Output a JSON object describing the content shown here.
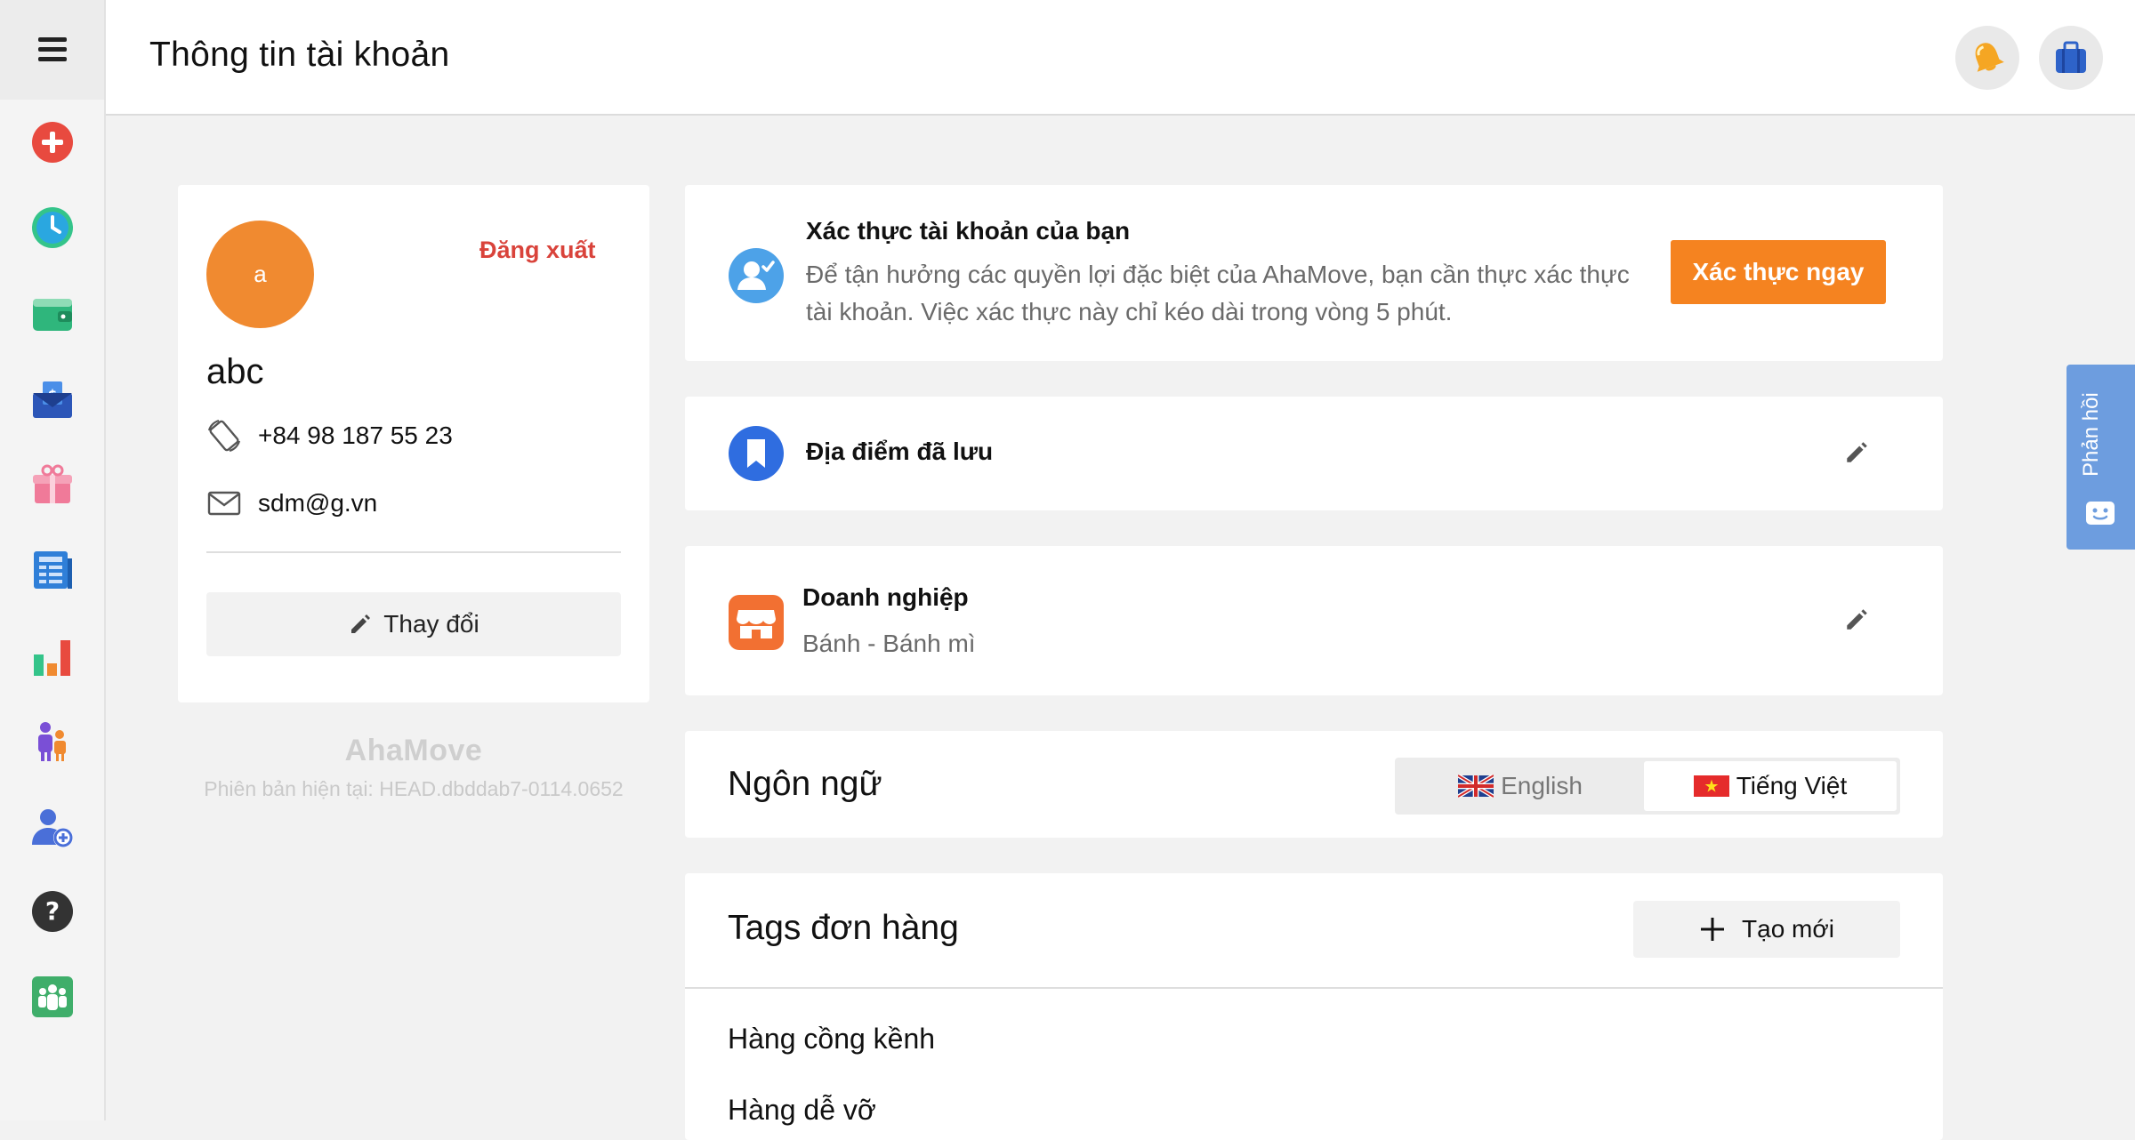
{
  "header": {
    "title": "Thông tin tài khoản",
    "notification_icon": "bell-icon",
    "jobs_icon": "briefcase-icon"
  },
  "sidebar": {
    "items": [
      {
        "icon": "create-order-icon",
        "color": "#e84a3f"
      },
      {
        "icon": "history-clock-icon",
        "color": "#2aa7e0"
      },
      {
        "icon": "wallet-icon",
        "color": "#2fb67c"
      },
      {
        "icon": "cod-payment-icon",
        "color": "#2c56b8"
      },
      {
        "icon": "gift-icon",
        "color": "#f07a99"
      },
      {
        "icon": "report-list-icon",
        "color": "#2f7fd8"
      },
      {
        "icon": "statistics-chart-icon",
        "color": "#f08a30"
      },
      {
        "icon": "team-icon",
        "color": "#7a4fd6"
      },
      {
        "icon": "add-user-icon",
        "color": "#4a6fd8"
      },
      {
        "icon": "help-icon",
        "color": "#333333"
      },
      {
        "icon": "community-icon",
        "color": "#3fae6a"
      }
    ]
  },
  "profile": {
    "avatar_letter": "a",
    "avatar_color": "#f08a30",
    "logout_label": "Đăng xuất",
    "name": "abc",
    "phone": "+84 98 187 55 23",
    "email": "sdm@g.vn",
    "change_label": "Thay đổi"
  },
  "brand": {
    "name": "AhaMove",
    "version": "Phiên bản hiện tại: HEAD.dbddab7-0114.0652"
  },
  "verify": {
    "title": "Xác thực tài khoản của bạn",
    "description": "Để tận hưởng các quyền lợi đặc biệt của AhaMove, bạn cần thực xác thực tài khoản. Việc xác thực này chỉ kéo dài trong vòng 5 phút.",
    "button_label": "Xác thực ngay",
    "accent": "#f58320"
  },
  "saved_places": {
    "title": "Địa điểm đã lưu"
  },
  "business": {
    "title": "Doanh nghiệp",
    "subtitle": "Bánh - Bánh mì"
  },
  "language": {
    "title": "Ngôn ngữ",
    "options": [
      "English",
      "Tiếng Việt"
    ],
    "selected": "Tiếng Việt"
  },
  "tags": {
    "title": "Tags đơn hàng",
    "new_label": "Tạo mới",
    "items": [
      "Hàng cồng kềnh",
      "Hàng dễ vỡ"
    ]
  },
  "feedback": {
    "label": "Phản hồi",
    "color": "#6d9ddf"
  }
}
